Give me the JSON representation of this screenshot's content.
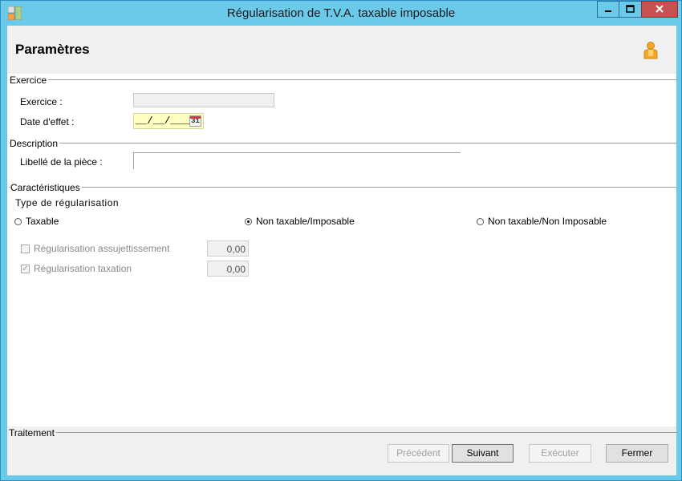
{
  "window": {
    "title": "Régularisation de T.V.A. taxable imposable",
    "controls": {
      "minimize": "minimize-icon",
      "maximize": "maximize-icon",
      "close": "close-icon"
    }
  },
  "header": {
    "title": "Paramètres",
    "user_icon": "user-icon"
  },
  "exercice_group": {
    "label": "Exercice",
    "exercice_label": "Exercice :",
    "exercice_value": "",
    "date_label": "Date d'effet :",
    "date_value": "__/__/____",
    "calendar_text": "31"
  },
  "description_group": {
    "label": "Description",
    "libelle_label": "Libellé de la pièce :",
    "libelle_value": ""
  },
  "caracteristiques_group": {
    "label": "Caractéristiques",
    "type_title": "Type de régularisation",
    "options": [
      {
        "label": "Taxable",
        "checked": false
      },
      {
        "label": "Non taxable/Imposable",
        "checked": true
      },
      {
        "label": "Non taxable/Non Imposable",
        "checked": false
      }
    ],
    "checks": [
      {
        "label": "Régularisation assujettissement",
        "checked": false,
        "value": "0,00"
      },
      {
        "label": "Régularisation taxation",
        "checked": true,
        "value": "0,00"
      }
    ]
  },
  "traitement_group": {
    "label": "Traitement",
    "buttons": {
      "precedent": "Précédent",
      "suivant": "Suivant",
      "executer": "Exécuter",
      "fermer": "Fermer"
    }
  }
}
